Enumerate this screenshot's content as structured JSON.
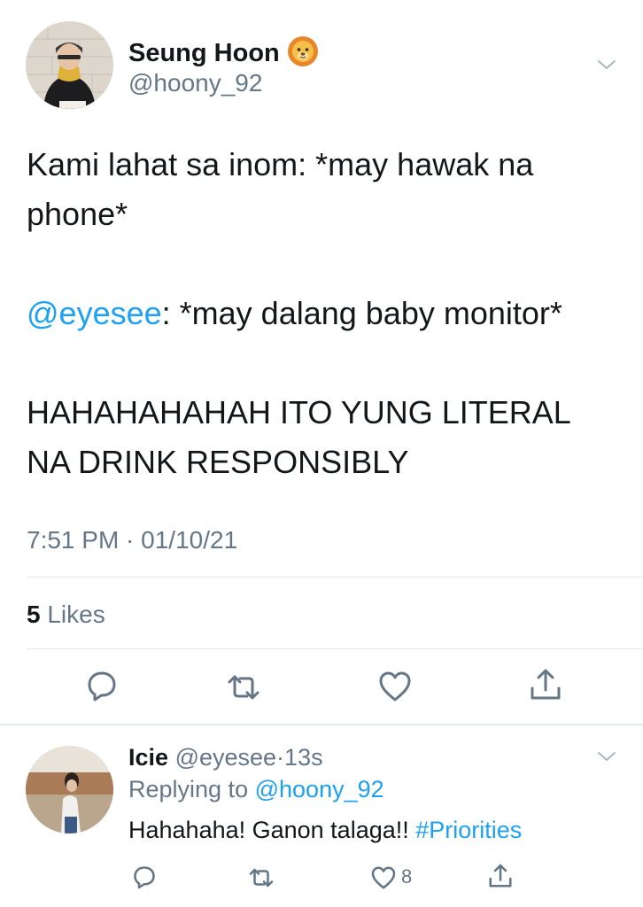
{
  "tweet": {
    "author_name": "Seung Hoon",
    "author_emoji_icon": "lion-emoji",
    "author_handle": "@hoony_92",
    "lines": [
      "Kami lahat sa inom: *may hawak na phone*",
      "",
      "",
      "@eyesee: *may dalang baby monitor*",
      "",
      "HAHAHAHAHAH ITO YUNG LITERAL NA DRINK RESPONSIBLY"
    ],
    "mention": "@eyesee",
    "line3_rest": ": *may dalang baby monitor*",
    "line1": "Kami lahat sa inom: *may hawak na",
    "line1b": "phone*",
    "line4": "HAHAHAHAHAH ITO YUNG LITERAL",
    "line4b": "NA DRINK RESPONSIBLY",
    "timestamp": "7:51 PM · 01/10/21",
    "likes_count": "5",
    "likes_label": "Likes",
    "actions": [
      "reply-icon",
      "retweet-icon",
      "like-icon",
      "share-icon"
    ]
  },
  "reply": {
    "author_name": "Icie",
    "author_handle": "@eyesee",
    "separator": "·",
    "time": "13s",
    "replying_prefix": "Replying to",
    "replying_to": "@hoony_92",
    "text": "Hahahaha! Ganon talaga!!",
    "hashtag": "#Priorities",
    "like_count": "8"
  },
  "colors": {
    "accent": "#1da1f2",
    "secondary_text": "#657786",
    "primary_text": "#14171a",
    "divider": "#e1e8ed"
  }
}
